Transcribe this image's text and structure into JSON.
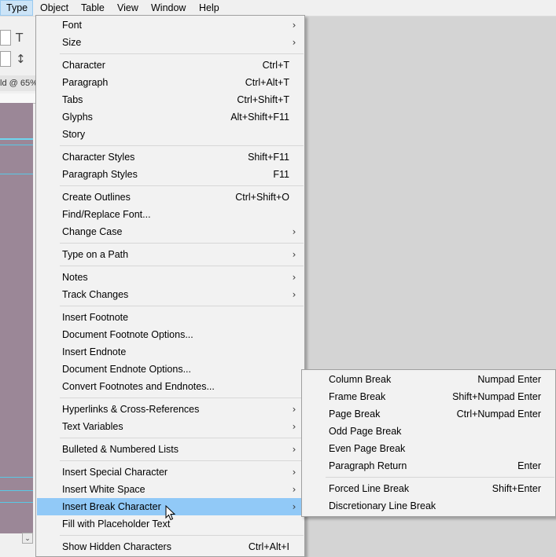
{
  "menubar": {
    "items": [
      "Type",
      "Object",
      "Table",
      "View",
      "Window",
      "Help"
    ],
    "active": "Type"
  },
  "app": {
    "zoom_label": "ld @ 65%"
  },
  "icons": {
    "text_tool": "type-size-icon",
    "leading_tool": "leading-icon",
    "submenu": "chevron-right-icon",
    "cursor": "mouse-pointer-icon"
  },
  "colors": {
    "highlight": "#91c9f7",
    "pasteboard": "#9b8797",
    "guide": "#58c9e6"
  },
  "type_menu": {
    "font": "Font",
    "size": "Size",
    "character": "Character",
    "character_sc": "Ctrl+T",
    "paragraph": "Paragraph",
    "paragraph_sc": "Ctrl+Alt+T",
    "tabs": "Tabs",
    "tabs_sc": "Ctrl+Shift+T",
    "glyphs": "Glyphs",
    "glyphs_sc": "Alt+Shift+F11",
    "story": "Story",
    "character_styles": "Character Styles",
    "character_styles_sc": "Shift+F11",
    "paragraph_styles": "Paragraph Styles",
    "paragraph_styles_sc": "F11",
    "create_outlines": "Create Outlines",
    "create_outlines_sc": "Ctrl+Shift+O",
    "find_replace_font": "Find/Replace Font...",
    "change_case": "Change Case",
    "type_on_path": "Type on a Path",
    "notes": "Notes",
    "track_changes": "Track Changes",
    "insert_footnote": "Insert Footnote",
    "doc_footnote_options": "Document Footnote Options...",
    "insert_endnote": "Insert Endnote",
    "doc_endnote_options": "Document Endnote Options...",
    "convert_footnotes": "Convert Footnotes and Endnotes...",
    "hyperlinks": "Hyperlinks & Cross-References",
    "text_variables": "Text Variables",
    "bulleted_lists": "Bulleted & Numbered Lists",
    "insert_special": "Insert Special Character",
    "insert_white_space": "Insert White Space",
    "insert_break": "Insert Break Character",
    "fill_placeholder": "Fill with Placeholder Text",
    "show_hidden": "Show Hidden Characters",
    "show_hidden_sc": "Ctrl+Alt+I"
  },
  "break_submenu": {
    "column_break": "Column Break",
    "column_break_sc": "Numpad Enter",
    "frame_break": "Frame Break",
    "frame_break_sc": "Shift+Numpad Enter",
    "page_break": "Page Break",
    "page_break_sc": "Ctrl+Numpad Enter",
    "odd_page_break": "Odd Page Break",
    "even_page_break": "Even Page Break",
    "paragraph_return": "Paragraph Return",
    "paragraph_return_sc": "Enter",
    "forced_line_break": "Forced Line Break",
    "forced_line_break_sc": "Shift+Enter",
    "discretionary_line_break": "Discretionary Line Break"
  }
}
